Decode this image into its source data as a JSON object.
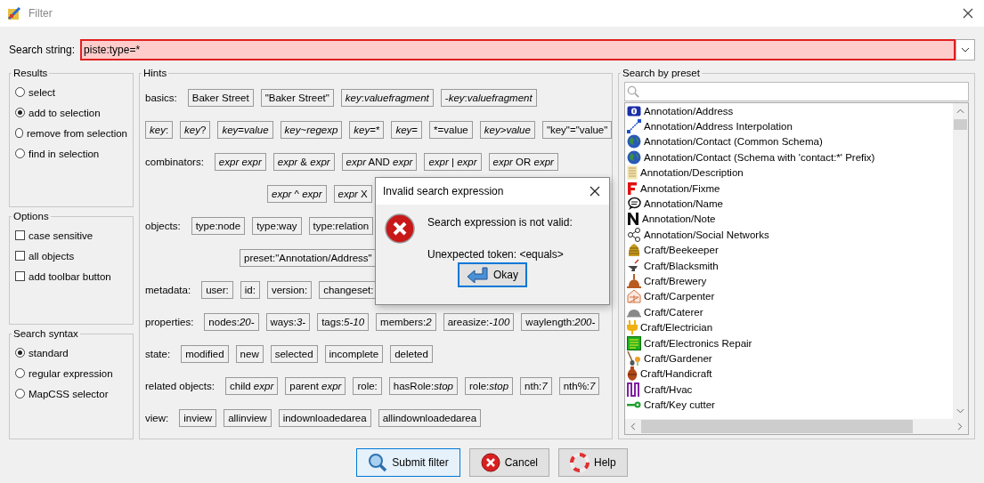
{
  "window": {
    "title": "Filter"
  },
  "search": {
    "label": "Search string:",
    "value": "piste:type=*",
    "invalid": true
  },
  "results": {
    "title": "Results",
    "options": [
      {
        "label": "select",
        "selected": false
      },
      {
        "label": "add to selection",
        "selected": true
      },
      {
        "label": "remove from selection",
        "selected": false
      },
      {
        "label": "find in selection",
        "selected": false
      }
    ]
  },
  "options": {
    "title": "Options",
    "items": [
      {
        "label": "case sensitive",
        "checked": false
      },
      {
        "label": "all objects",
        "checked": false
      },
      {
        "label": "add toolbar button",
        "checked": false
      }
    ]
  },
  "syntax": {
    "title": "Search syntax",
    "options": [
      {
        "label": "standard",
        "selected": true
      },
      {
        "label": "regular expression",
        "selected": false
      },
      {
        "label": "MapCSS selector",
        "selected": false
      }
    ]
  },
  "hints": {
    "title": "Hints",
    "rows": [
      {
        "kind": "labeled",
        "label": "basics:",
        "chips": [
          "Baker Street",
          "\"Baker Street\"",
          "*key*:*valuefragment*",
          "-*key*:*valuefragment*"
        ]
      },
      {
        "kind": "plain",
        "chips": [
          "*key*:",
          "*key*?",
          "*key*=*value*",
          "*key*~*regexp*",
          "*key*=*",
          "*key*=",
          "*=value",
          "*key*>*value*",
          "\"key\"=\"value\""
        ]
      },
      {
        "kind": "labeled",
        "label": "combinators:",
        "chips": [
          "*expr* *expr*",
          "*expr* & *expr*",
          "*expr* AND *expr*",
          "*expr* | *expr*",
          "*expr* OR *expr*"
        ]
      },
      {
        "kind": "wrap",
        "chips": [
          "*expr* ^ *expr*",
          "*expr* X"
        ]
      },
      {
        "kind": "labeled",
        "label": "objects:",
        "chips": [
          "type:node",
          "type:way",
          "type:relation"
        ]
      },
      {
        "kind": "wrap2",
        "chips": [
          "preset:\"Annotation/Address\""
        ]
      },
      {
        "kind": "labeled",
        "label": "metadata:",
        "chips": [
          "user:",
          "id:",
          "version:",
          "changeset:"
        ]
      },
      {
        "kind": "labeled",
        "label": "properties:",
        "chips": [
          "nodes:*20-*",
          "ways:*3-*",
          "tags:*5-10*",
          "members:*2*",
          "areasize:*-100*",
          "waylength:*200-*"
        ]
      },
      {
        "kind": "labeled",
        "label": "state:",
        "chips": [
          "modified",
          "new",
          "selected",
          "incomplete",
          "deleted"
        ]
      },
      {
        "kind": "labeled",
        "label": "related objects:",
        "chips": [
          "child *expr*",
          "parent *expr*",
          "role:",
          "hasRole:*stop*",
          "role:*stop*",
          "nth:*7*",
          "nth%:*7*"
        ]
      },
      {
        "kind": "labeled",
        "label": "view:",
        "chips": [
          "inview",
          "allinview",
          "indownloadedarea",
          "allindownloadedarea"
        ]
      }
    ]
  },
  "presets": {
    "title": "Search by preset",
    "items": [
      "Annotation/Address",
      "Annotation/Address Interpolation",
      "Annotation/Contact (Common Schema)",
      "Annotation/Contact (Schema with 'contact:*' Prefix)",
      "Annotation/Description",
      "Annotation/Fixme",
      "Annotation/Name",
      "Annotation/Note",
      "Annotation/Social Networks",
      "Craft/Beekeeper",
      "Craft/Blacksmith",
      "Craft/Brewery",
      "Craft/Carpenter",
      "Craft/Caterer",
      "Craft/Electrician",
      "Craft/Electronics Repair",
      "Craft/Gardener",
      "Craft/Handicraft",
      "Craft/Hvac",
      "Craft/Key cutter"
    ]
  },
  "buttons": [
    {
      "label": "Submit filter",
      "kind": "submit",
      "focused": true
    },
    {
      "label": "Cancel",
      "kind": "cancel",
      "focused": false
    },
    {
      "label": "Help",
      "kind": "help",
      "focused": false
    }
  ],
  "dialog": {
    "title": "Invalid search expression",
    "message": "Search expression is not valid:",
    "detail": "Unexpected token: <equals>",
    "button": "Okay"
  }
}
